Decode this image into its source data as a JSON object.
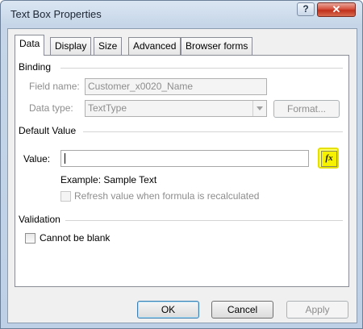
{
  "window": {
    "title": "Text Box Properties",
    "help_label": "?",
    "close_label": "✕"
  },
  "tabs": [
    {
      "label": "Data",
      "active": true
    },
    {
      "label": "Display"
    },
    {
      "label": "Size"
    },
    {
      "label": "Advanced"
    },
    {
      "label": "Browser forms"
    }
  ],
  "binding": {
    "group_label": "Binding",
    "field_name_label": "Field name:",
    "field_name_value": "Customer_x0020_Name",
    "data_type_label": "Data type:",
    "data_type_value": "TextType",
    "format_button": "Format..."
  },
  "default_value": {
    "group_label": "Default Value",
    "value_label": "Value:",
    "value": "",
    "fx_label": "fx",
    "example_text": "Example: Sample Text",
    "refresh_label": "Refresh value when formula is recalculated",
    "refresh_checked": false
  },
  "validation": {
    "group_label": "Validation",
    "cannot_be_blank_label": "Cannot be blank",
    "cannot_be_blank_checked": false
  },
  "buttons": {
    "ok": "OK",
    "cancel": "Cancel",
    "apply": "Apply"
  },
  "colors": {
    "highlight": "#ffff66",
    "title_bar": "#c6d6e8",
    "close_button": "#c8412c"
  }
}
